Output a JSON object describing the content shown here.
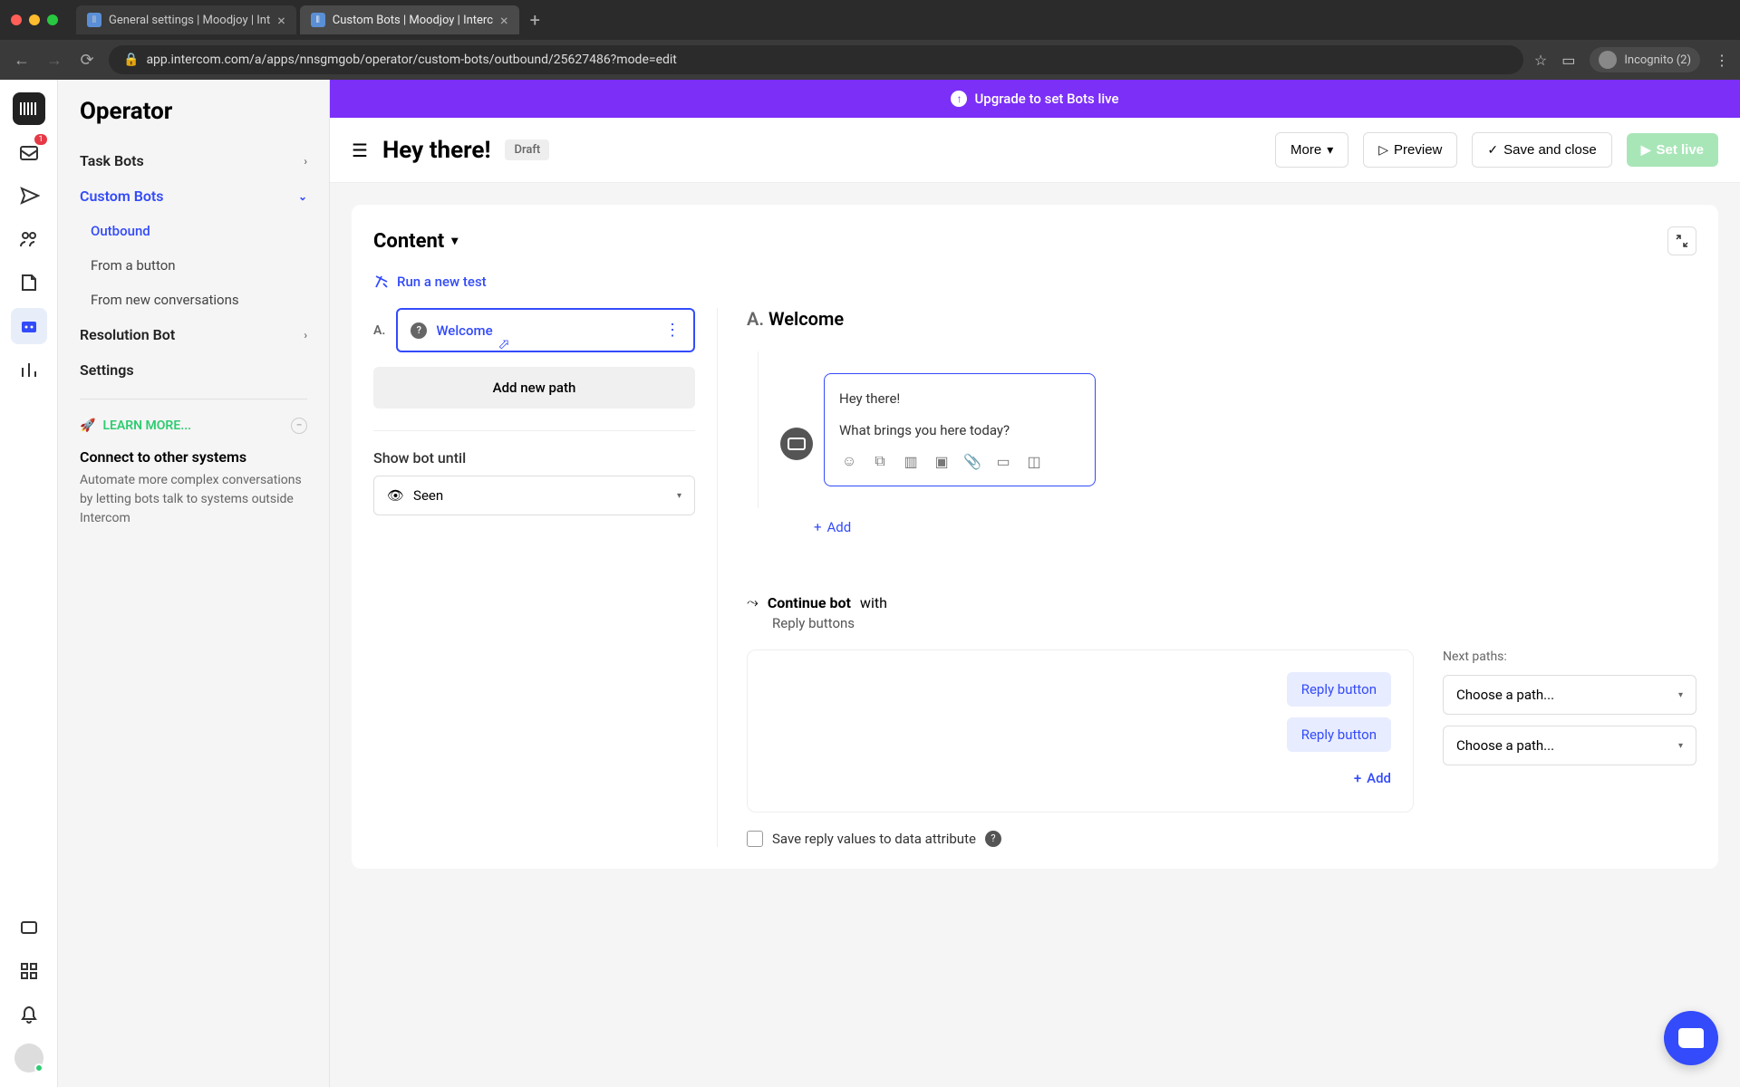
{
  "browser": {
    "tabs": [
      {
        "title": "General settings | Moodjoy | Int"
      },
      {
        "title": "Custom Bots | Moodjoy | Interc"
      }
    ],
    "url": "app.intercom.com/a/apps/nnsgmgob/operator/custom-bots/outbound/25627486?mode=edit",
    "incognito": "Incognito (2)"
  },
  "rail": {
    "inbox_badge": "1"
  },
  "sidebar": {
    "title": "Operator",
    "items": {
      "task_bots": "Task Bots",
      "custom_bots": "Custom Bots",
      "outbound": "Outbound",
      "from_button": "From a button",
      "from_new_conv": "From new conversations",
      "resolution_bot": "Resolution Bot",
      "settings": "Settings"
    },
    "learn_more": {
      "label": "LEARN MORE...",
      "card_title": "Connect to other systems",
      "card_body": "Automate more complex conversations by letting bots talk to systems outside Intercom"
    }
  },
  "banner": {
    "text": "Upgrade to set Bots live"
  },
  "header": {
    "title": "Hey there!",
    "badge": "Draft",
    "more": "More",
    "preview": "Preview",
    "save_close": "Save and close",
    "set_live": "Set live"
  },
  "content": {
    "title": "Content",
    "run_test": "Run a new test",
    "path": {
      "letter": "A.",
      "name": "Welcome",
      "add_path": "Add new path",
      "show_until": "Show bot until",
      "show_until_value": "Seen"
    },
    "editor": {
      "heading_letter": "A.",
      "heading_name": "Welcome",
      "message_line1": "Hey there!",
      "message_line2": "What brings you here today?",
      "add": "Add"
    },
    "continue": {
      "label_bold": "Continue bot",
      "label_with": "with",
      "sub": "Reply buttons",
      "reply_button": "Reply button",
      "add": "Add",
      "next_paths": "Next paths:",
      "choose_path": "Choose a path..."
    },
    "save_reply": {
      "label": "Save reply values to data attribute"
    }
  }
}
